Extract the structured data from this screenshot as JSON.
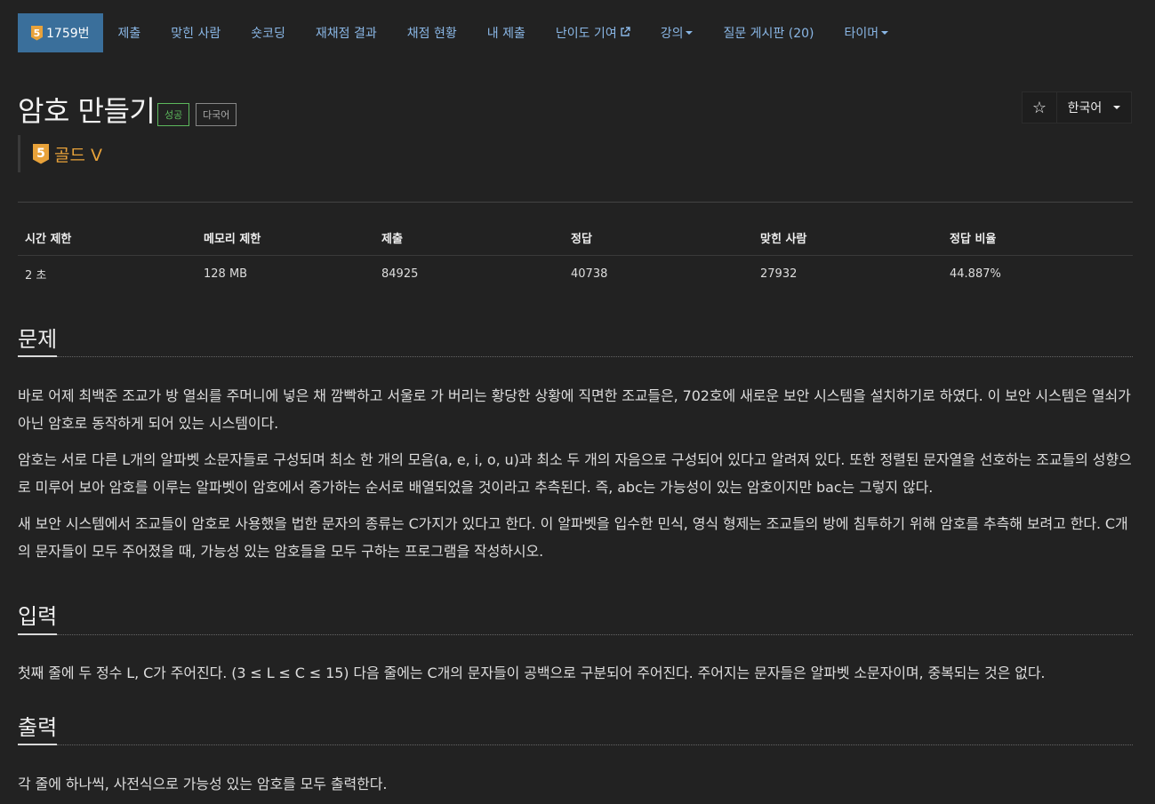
{
  "nav": {
    "problem_no": "1759번",
    "tier_num": "5",
    "items": [
      {
        "label": "제출"
      },
      {
        "label": "맞힌 사람"
      },
      {
        "label": "숏코딩"
      },
      {
        "label": "재채점 결과"
      },
      {
        "label": "채점 현황"
      },
      {
        "label": "내 제출"
      },
      {
        "label": "난이도 기여"
      },
      {
        "label": "강의"
      },
      {
        "label": "질문 게시판 (20)"
      },
      {
        "label": "타이머"
      }
    ]
  },
  "title": "암호 만들기",
  "labels": {
    "success": "성공",
    "multi": "다국어"
  },
  "language": "한국어",
  "star": "☆",
  "tier": {
    "num": "5",
    "name": "골드 V",
    "color": "#e8a23a"
  },
  "stats": {
    "headers": [
      "시간 제한",
      "메모리 제한",
      "제출",
      "정답",
      "맞힌 사람",
      "정답 비율"
    ],
    "values": [
      "2 초",
      "128 MB",
      "84925",
      "40738",
      "27932",
      "44.887%"
    ]
  },
  "sections": {
    "problem": {
      "title": "문제",
      "paragraphs": [
        "바로 어제 최백준 조교가 방 열쇠를 주머니에 넣은 채 깜빡하고 서울로 가 버리는 황당한 상황에 직면한 조교들은, 702호에 새로운 보안 시스템을 설치하기로 하였다. 이 보안 시스템은 열쇠가 아닌 암호로 동작하게 되어 있는 시스템이다.",
        "암호는 서로 다른 L개의 알파벳 소문자들로 구성되며 최소 한 개의 모음(a, e, i, o, u)과 최소 두 개의 자음으로 구성되어 있다고 알려져 있다. 또한 정렬된 문자열을 선호하는 조교들의 성향으로 미루어 보아 암호를 이루는 알파벳이 암호에서 증가하는 순서로 배열되었을 것이라고 추측된다. 즉, abc는 가능성이 있는 암호이지만 bac는 그렇지 않다.",
        "새 보안 시스템에서 조교들이 암호로 사용했을 법한 문자의 종류는 C가지가 있다고 한다. 이 알파벳을 입수한 민식, 영식 형제는 조교들의 방에 침투하기 위해 암호를 추측해 보려고 한다. C개의 문자들이 모두 주어졌을 때, 가능성 있는 암호들을 모두 구하는 프로그램을 작성하시오."
      ]
    },
    "input": {
      "title": "입력",
      "paragraphs": [
        "첫째 줄에 두 정수 L, C가 주어진다. (3 ≤ L ≤ C ≤ 15) 다음 줄에는 C개의 문자들이 공백으로 구분되어 주어진다. 주어지는 문자들은 알파벳 소문자이며, 중복되는 것은 없다."
      ]
    },
    "output": {
      "title": "출력",
      "paragraphs": [
        "각 줄에 하나씩, 사전식으로 가능성 있는 암호를 모두 출력한다."
      ]
    }
  }
}
